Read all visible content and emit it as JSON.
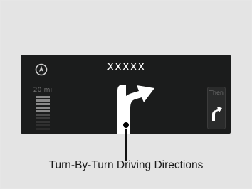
{
  "display": {
    "street_name": "XXXXX",
    "distance_to_turn": "20 mi",
    "then_label": "Then",
    "compass_icon": "compass-icon",
    "main_direction_icon": "turn-right-arrow-icon",
    "next_direction_icon": "turn-right-small-arrow-icon"
  },
  "callout": {
    "caption": "Turn-By-Turn Driving Directions"
  },
  "colors": {
    "screen_background": "#1b1c1c",
    "page_background": "#e6e6e6",
    "arrow": "#ffffff",
    "muted_text": "#6f6f6f"
  }
}
